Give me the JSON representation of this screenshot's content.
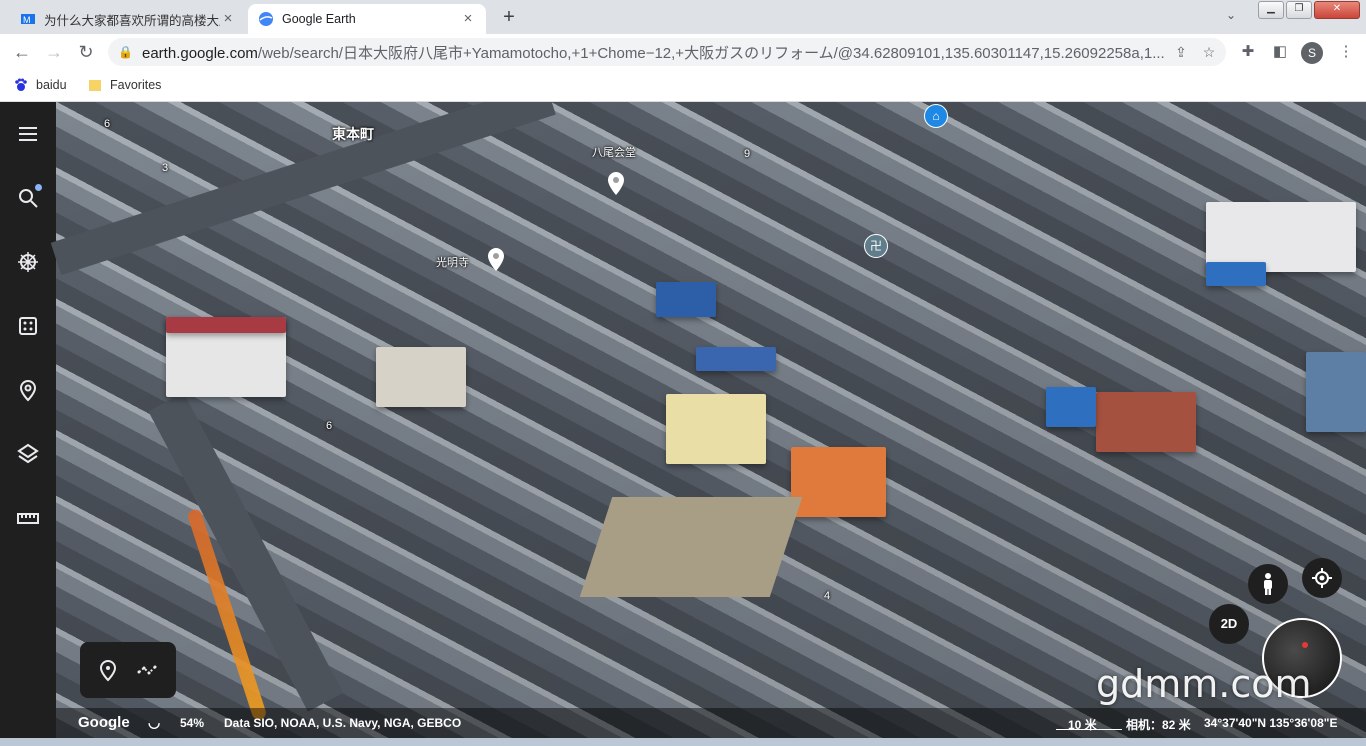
{
  "browser": {
    "tabs": [
      {
        "title": "为什么大家都喜欢所谓的高楼大厦",
        "active": false
      },
      {
        "title": "Google Earth",
        "active": true
      }
    ],
    "url_host": "earth.google.com",
    "url_path": "/web/search/日本大阪府八尾市+Yamamotocho,+1+Chome−12,+大阪ガスのリフォーム/@34.62809101,135.60301147,15.26092258a,1...",
    "profile_initial": "S",
    "bookmarks": [
      {
        "label": "baidu",
        "icon": "baidu-paw-icon"
      },
      {
        "label": "Favorites",
        "icon": "folder-icon"
      }
    ]
  },
  "earth": {
    "sidebar_icons": [
      "menu-icon",
      "search-icon",
      "voyager-wheel-icon",
      "dice-icon",
      "place-marker-icon",
      "layers-icon",
      "ruler-icon"
    ],
    "map_labels": {
      "district": "東本町",
      "hall": "八尾会堂",
      "temple": "光明寺",
      "num_6_top": "6",
      "num_3": "3",
      "num_9": "9",
      "num_6_mid": "6",
      "num_4": "4"
    },
    "view_toggle": "2D",
    "watermark": "gdmm.com",
    "status": {
      "logo": "Google",
      "loading": "54%",
      "attribution": "Data SIO, NOAA, U.S. Navy, NGA, GEBCO",
      "scale": "10 米",
      "camera": "相机：82 米",
      "coords": "34°37'40\"N 135°36'08\"E"
    }
  }
}
